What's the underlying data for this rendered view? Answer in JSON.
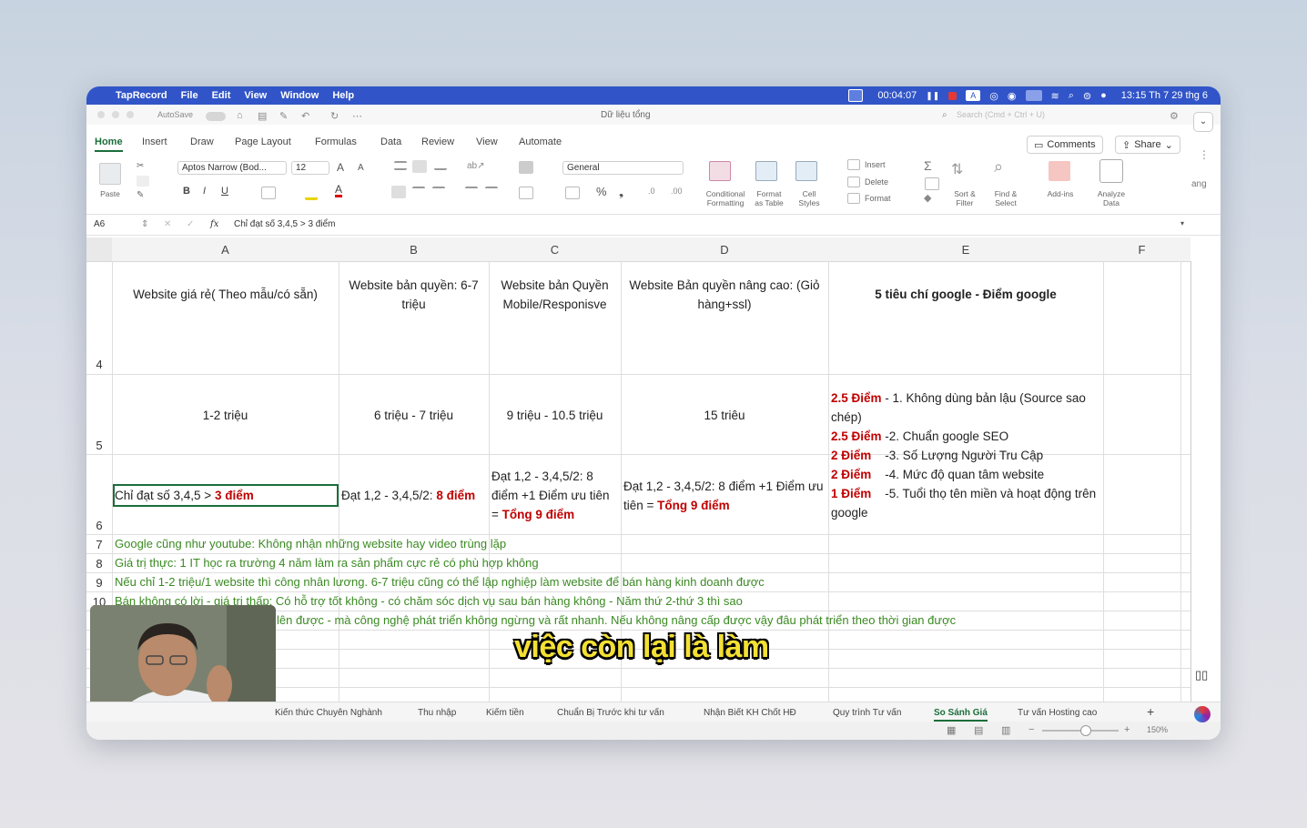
{
  "menubar": {
    "app": "TapRecord",
    "items": [
      "File",
      "Edit",
      "View",
      "Window",
      "Help"
    ],
    "timer": "00:04:07",
    "clock": "13:15 Th 7 29 thg 6"
  },
  "titlebar": {
    "autosave": "AutoSave",
    "doc_title": "Dữ liệu tổng",
    "search_placeholder": "Search (Cmd + Ctrl + U)"
  },
  "ribbon_tabs": [
    "Home",
    "Insert",
    "Draw",
    "Page Layout",
    "Formulas",
    "Data",
    "Review",
    "View",
    "Automate"
  ],
  "buttons": {
    "comments": "Comments",
    "share": "Share"
  },
  "ribbon": {
    "paste": "Paste",
    "font_name": "Aptos Narrow (Bod...",
    "font_size": "12",
    "number_format": "General",
    "insert": "Insert",
    "delete": "Delete",
    "format": "Format",
    "cond_fmt_1": "Conditional",
    "cond_fmt_2": "Formatting",
    "fmt_table_1": "Format",
    "fmt_table_2": "as Table",
    "cell_styles_1": "Cell",
    "cell_styles_2": "Styles",
    "sort_1": "Sort &",
    "sort_2": "Filter",
    "find_1": "Find &",
    "find_2": "Select",
    "addins": "Add-ins",
    "analyze_1": "Analyze",
    "analyze_2": "Data",
    "side_text": "ang"
  },
  "formula_bar": {
    "cell_ref": "A6",
    "fx": "fx",
    "formula": "Chỉ đạt số 3,4,5 > 3 điểm"
  },
  "columns": [
    "A",
    "B",
    "C",
    "D",
    "E",
    "F"
  ],
  "rows": {
    "r4": {
      "num": "4",
      "A": "Website giá rẻ( Theo mẫu/có sẵn)",
      "B": "Website bản quyền: 6-7 triệu",
      "C": "Website bản Quyền Mobile/Responisve",
      "D": "Website Bản quyền nâng cao: (Giỏ hàng+ssl)",
      "E": "5 tiêu chí google - Điểm google"
    },
    "r5": {
      "num": "5",
      "A": "1-2 triệu",
      "B": "6 triệu - 7 triệu",
      "C": "9 triệu - 10.5 triệu",
      "D": "15 triêu",
      "E_lines": [
        {
          "pts": "2.5 Điểm",
          "txt": " - 1. Không dùng bản lậu (Source sao"
        },
        {
          "pts": "",
          "txt": "chép)"
        },
        {
          "pts": "2.5 Điểm",
          "txt": " -2. Chuẩn google SEO"
        },
        {
          "pts": "2 Điểm",
          "txt": "    -3. Số Lượng Người Tru Cập"
        },
        {
          "pts": "2 Điểm",
          "txt": "    -4. Mức độ quan tâm website"
        },
        {
          "pts": "1 Điểm",
          "txt": "    -5. Tuổi thọ tên miền và hoạt động trên"
        },
        {
          "pts": "",
          "txt": "google"
        }
      ]
    },
    "r6": {
      "num": "6",
      "A_pre": "Chỉ đạt số 3,4,5 > ",
      "A_red": "3 điểm",
      "B_pre": "Đạt 1,2 - 3,4,5/2: ",
      "B_red": "8 điểm",
      "C_line1": "Đạt 1,2 - 3,4,5/2: 8",
      "C_line2": "điểm +1 Điểm ưu tiên",
      "C_line3_pre": "= ",
      "C_line3_red": "Tổng 9 điểm",
      "D_line1": "Đạt 1,2 - 3,4,5/2: 8 điểm +1 Điểm ưu",
      "D_line2_pre": "tiên = ",
      "D_line2_red": "Tổng 9 điểm"
    },
    "notes": [
      {
        "num": "7",
        "text": "Google cũng như youtube: Không nhận những website hay video trùng lặp"
      },
      {
        "num": "8",
        "text": "Giá trị thực: 1 IT học ra trường 4 năm làm ra sản phẩm cực rẻ có phù hợp không"
      },
      {
        "num": "9",
        "text": "Nếu chỉ 1-2 triệu/1 website thì công nhân lương. 6-7 triệu cũng có thể lập nghiệp làm website để bán hàng kinh doanh được"
      },
      {
        "num": "10",
        "text": "Bán không có lời - giá trị thấp: Có hỗ trợ tốt không - có chăm sóc dịch vụ sau bán hàng không - Năm thứ 2-thứ 3 thì sao"
      },
      {
        "num": "",
        "text": "lên được - mà công nghệ phát triển không ngừng và rất nhanh. Nếu không nâng cấp được vậy đâu phát triển theo thời gian được"
      }
    ]
  },
  "sheet_tabs": [
    "Kiến thức Chuyên Nghành",
    "Thu nhập",
    "Kiếm tiền",
    "Chuẩn Bị Trước khi tư vấn",
    "Nhận Biết KH Chốt HĐ",
    "Quy trình Tư vấn",
    "So Sánh Giá",
    "Tư vấn Hosting cao"
  ],
  "active_sheet": "So Sánh Giá",
  "zoom": "150%",
  "subtitle": "việc còn lại là làm",
  "colors": {
    "menubar": "#3155c8",
    "accent_green": "#1b6e3b",
    "red_points": "#c00000",
    "note_green": "#3a8a22",
    "subtitle": "#f3e033"
  }
}
